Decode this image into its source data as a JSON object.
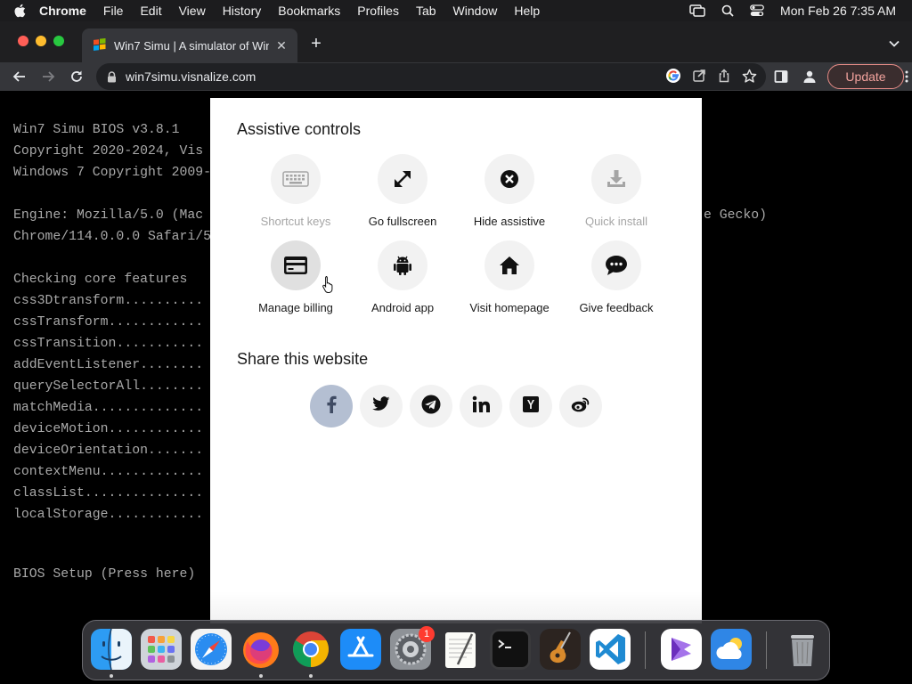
{
  "menubar": {
    "app_name": "Chrome",
    "items": [
      "File",
      "Edit",
      "View",
      "History",
      "Bookmarks",
      "Profiles",
      "Tab",
      "Window",
      "Help"
    ],
    "datetime": "Mon Feb 26  7:35 AM"
  },
  "browser": {
    "tab_title": "Win7 Simu | A simulator of Win",
    "tab_close": "✕",
    "new_tab": "+",
    "url": "win7simu.visnalize.com",
    "update_label": "Update"
  },
  "bios": {
    "lines": [
      "Win7 Simu BIOS v3.8.1",
      "Copyright 2020-2024, Vis",
      "Windows 7 Copyright 2009-",
      "",
      "Engine: Mozilla/5.0 (Mac",
      "Chrome/114.0.0.0 Safari/5",
      "",
      "Checking core features",
      "css3Dtransform..........",
      "cssTransform............",
      "cssTransition...........",
      "addEventListener........",
      "querySelectorAll........",
      "matchMedia..............",
      "deviceMotion............",
      "deviceOrientation.......",
      "contextMenu.............",
      "classList...............",
      "localStorage............"
    ],
    "engine_tail": "e Gecko)",
    "setup": "BIOS Setup (Press here)"
  },
  "modal": {
    "assistive_title": "Assistive controls",
    "controls": [
      {
        "label": "Shortcut keys",
        "icon": "keyboard-icon",
        "enabled": false
      },
      {
        "label": "Go fullscreen",
        "icon": "expand-icon",
        "enabled": true
      },
      {
        "label": "Hide assistive",
        "icon": "close-circle-icon",
        "enabled": true
      },
      {
        "label": "Quick install",
        "icon": "download-icon",
        "enabled": false
      },
      {
        "label": "Manage billing",
        "icon": "credit-card-icon",
        "enabled": true
      },
      {
        "label": "Android app",
        "icon": "android-icon",
        "enabled": true
      },
      {
        "label": "Visit homepage",
        "icon": "home-icon",
        "enabled": true
      },
      {
        "label": "Give feedback",
        "icon": "chat-bubble-icon",
        "enabled": true
      }
    ],
    "share_title": "Share this website",
    "share": [
      "facebook-icon",
      "twitter-icon",
      "telegram-icon",
      "linkedin-icon",
      "hacker-news-icon",
      "weibo-icon"
    ]
  },
  "dock": {
    "apps": [
      "finder-icon",
      "launchpad-icon",
      "safari-icon",
      "firefox-icon",
      "chrome-icon",
      "app-store-icon",
      "system-settings-icon",
      "textedit-icon",
      "terminal-icon",
      "garageband-icon",
      "vscode-icon",
      "visual-studio-icon",
      "weather-icon",
      "trash-icon"
    ],
    "settings_badge": "1"
  },
  "colors": {
    "bios_text": "#a9a9a9",
    "update_accent": "#f3a39e",
    "facebook_highlight": "#b4bfd2"
  }
}
